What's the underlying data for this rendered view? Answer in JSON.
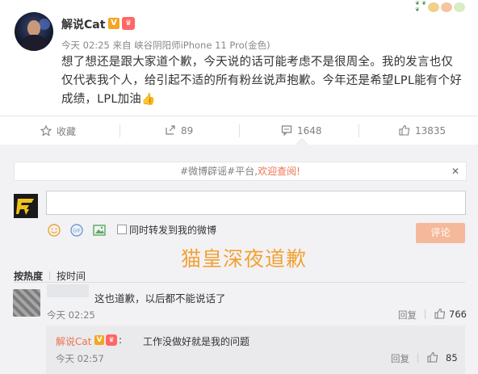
{
  "post": {
    "username": "解说Cat",
    "meta": "今天 02:25 来自 峡谷阴阳师iPhone 11 Pro(金色)",
    "content": "想了想还是跟大家道个歉，今天说的话可能考虑不是很周全。我的发言也仅仅代表我个人，给引起不适的所有粉丝说声抱歉。今年还是希望LPL能有个好成绩，LPL加油"
  },
  "actions": {
    "favorite": "收藏",
    "repost": "89",
    "comment": "1648",
    "like": "13835"
  },
  "comment_panel": {
    "notice_prefix": "#微博辟谣#平台,",
    "notice_link": "欢迎查阅!",
    "notice_close": "✕",
    "forward_label": "同时转发到我的微博",
    "submit_label": "评论",
    "sort_hot": "按热度",
    "sort_time": "按时间"
  },
  "watermark": "猫皇深夜道歉",
  "comments": [
    {
      "text": "这也道歉，以后都不能说话了",
      "time": "今天 02:25",
      "reply_label": "回复",
      "likes": "766",
      "sub_reply": {
        "author": "解说Cat",
        "text": "工作没做好就是我的问题",
        "time": "今天 02:57",
        "reply_label": "回复",
        "likes": "85"
      }
    }
  ],
  "colors": {
    "accent": "#eb7350",
    "watermark": "#f2a234",
    "panel_bg": "#f2f2f5",
    "submit_bg": "#f6b89b"
  },
  "icons": [
    "star-icon",
    "repost-icon",
    "comment-icon",
    "thumbs-up-icon",
    "emoji-icon",
    "gif-icon",
    "image-icon",
    "close-icon"
  ]
}
